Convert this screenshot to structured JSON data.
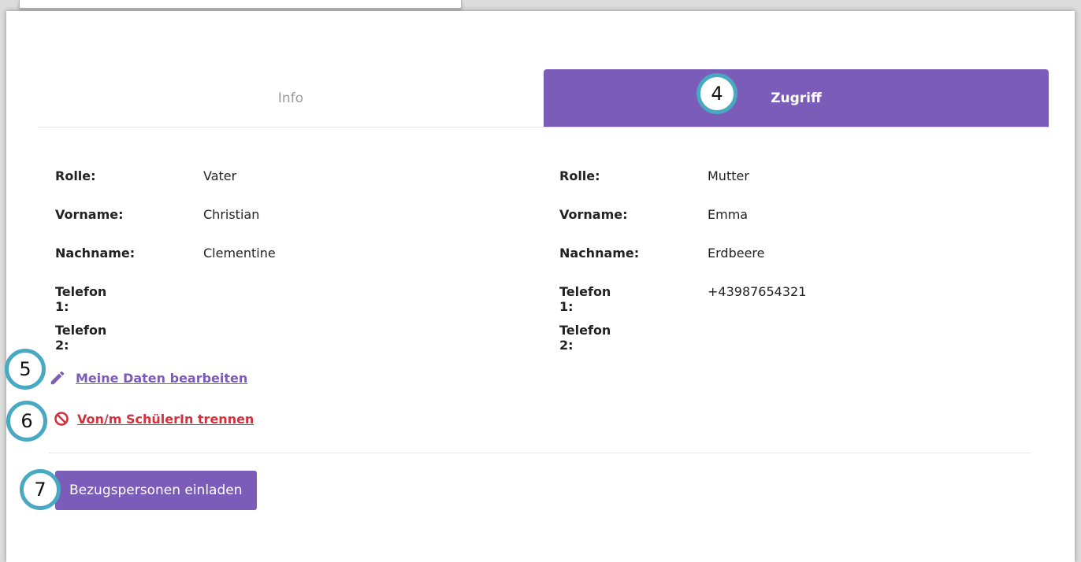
{
  "tabs": [
    {
      "label": "Info",
      "active": false
    },
    {
      "label": "Zugriff",
      "active": true
    }
  ],
  "persons": [
    {
      "rows": [
        {
          "label": "Rolle:",
          "value": "Vater"
        },
        {
          "label": "Vorname:",
          "value": "Christian"
        },
        {
          "label": "Nachname:",
          "value": "Clementine"
        },
        {
          "label": "Telefon 1:",
          "value": ""
        },
        {
          "label": "Telefon 2:",
          "value": ""
        }
      ]
    },
    {
      "rows": [
        {
          "label": "Rolle:",
          "value": "Mutter"
        },
        {
          "label": "Vorname:",
          "value": "Emma"
        },
        {
          "label": "Nachname:",
          "value": "Erdbeere"
        },
        {
          "label": "Telefon 1:",
          "value": "+43987654321"
        },
        {
          "label": "Telefon 2:",
          "value": ""
        }
      ]
    }
  ],
  "actions": {
    "edit_label": "Meine Daten bearbeiten",
    "edit_icon": "pencil-icon",
    "unlink_label": "Von/m SchülerIn trennen",
    "unlink_icon": "prohibited-icon"
  },
  "invite_button": "Bezugspersonen einladen",
  "callouts": [
    "4",
    "5",
    "6",
    "7"
  ],
  "colors": {
    "accent": "#7b5cb8",
    "danger": "#d62f3c",
    "callout_ring": "#49a8c2"
  }
}
